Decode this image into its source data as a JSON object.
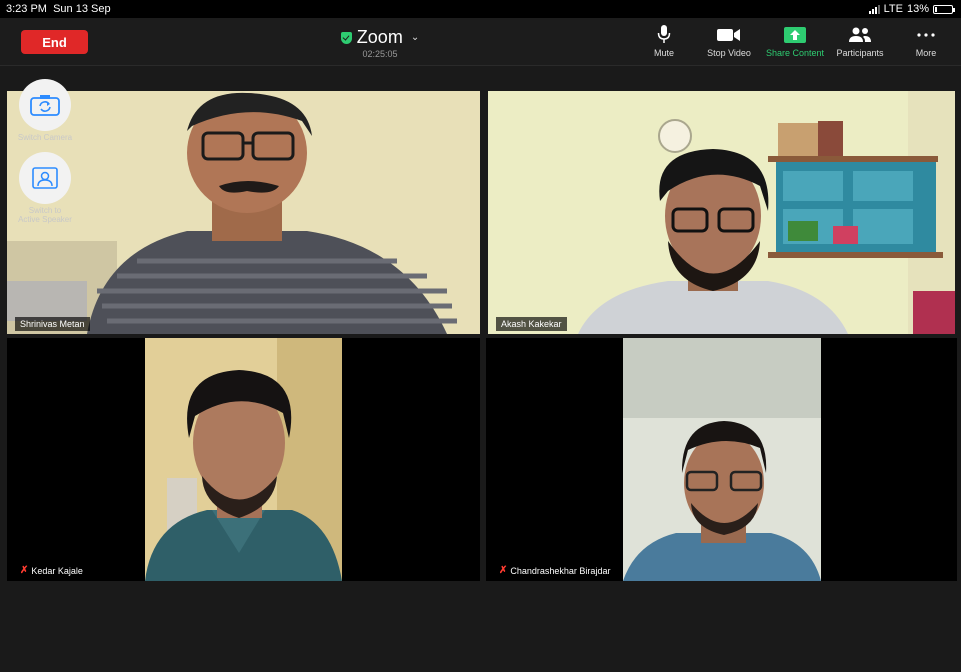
{
  "status_bar": {
    "time": "3:23 PM",
    "date": "Sun 13 Sep",
    "network": "LTE",
    "battery": "13%",
    "battery_level": 0.13
  },
  "toolbar": {
    "end_label": "End",
    "title": "Zoom",
    "timer": "02:25:05",
    "buttons": [
      {
        "label": "Mute",
        "icon": "microphone-icon"
      },
      {
        "label": "Stop Video",
        "icon": "video-camera-icon"
      },
      {
        "label": "Share Content",
        "icon": "share-screen-icon"
      },
      {
        "label": "Participants",
        "icon": "participants-icon"
      },
      {
        "label": "More",
        "icon": "more-icon"
      }
    ]
  },
  "side_controls": {
    "switch_camera": "Switch Camera",
    "switch_speaker_line1": "Switch to",
    "switch_speaker_line2": "Active Speaker"
  },
  "participants": [
    {
      "name": "Shrinivas Metan",
      "muted": false,
      "active": true
    },
    {
      "name": "Akash Kakekar",
      "muted": false,
      "active": false
    },
    {
      "name": "Kedar Kajale",
      "muted": true,
      "active": false
    },
    {
      "name": "Chandrashekhar Birajdar",
      "muted": true,
      "active": false
    }
  ],
  "colors": {
    "accent": "#2ecc71",
    "end": "#e02828",
    "mute": "#ff3b30"
  }
}
